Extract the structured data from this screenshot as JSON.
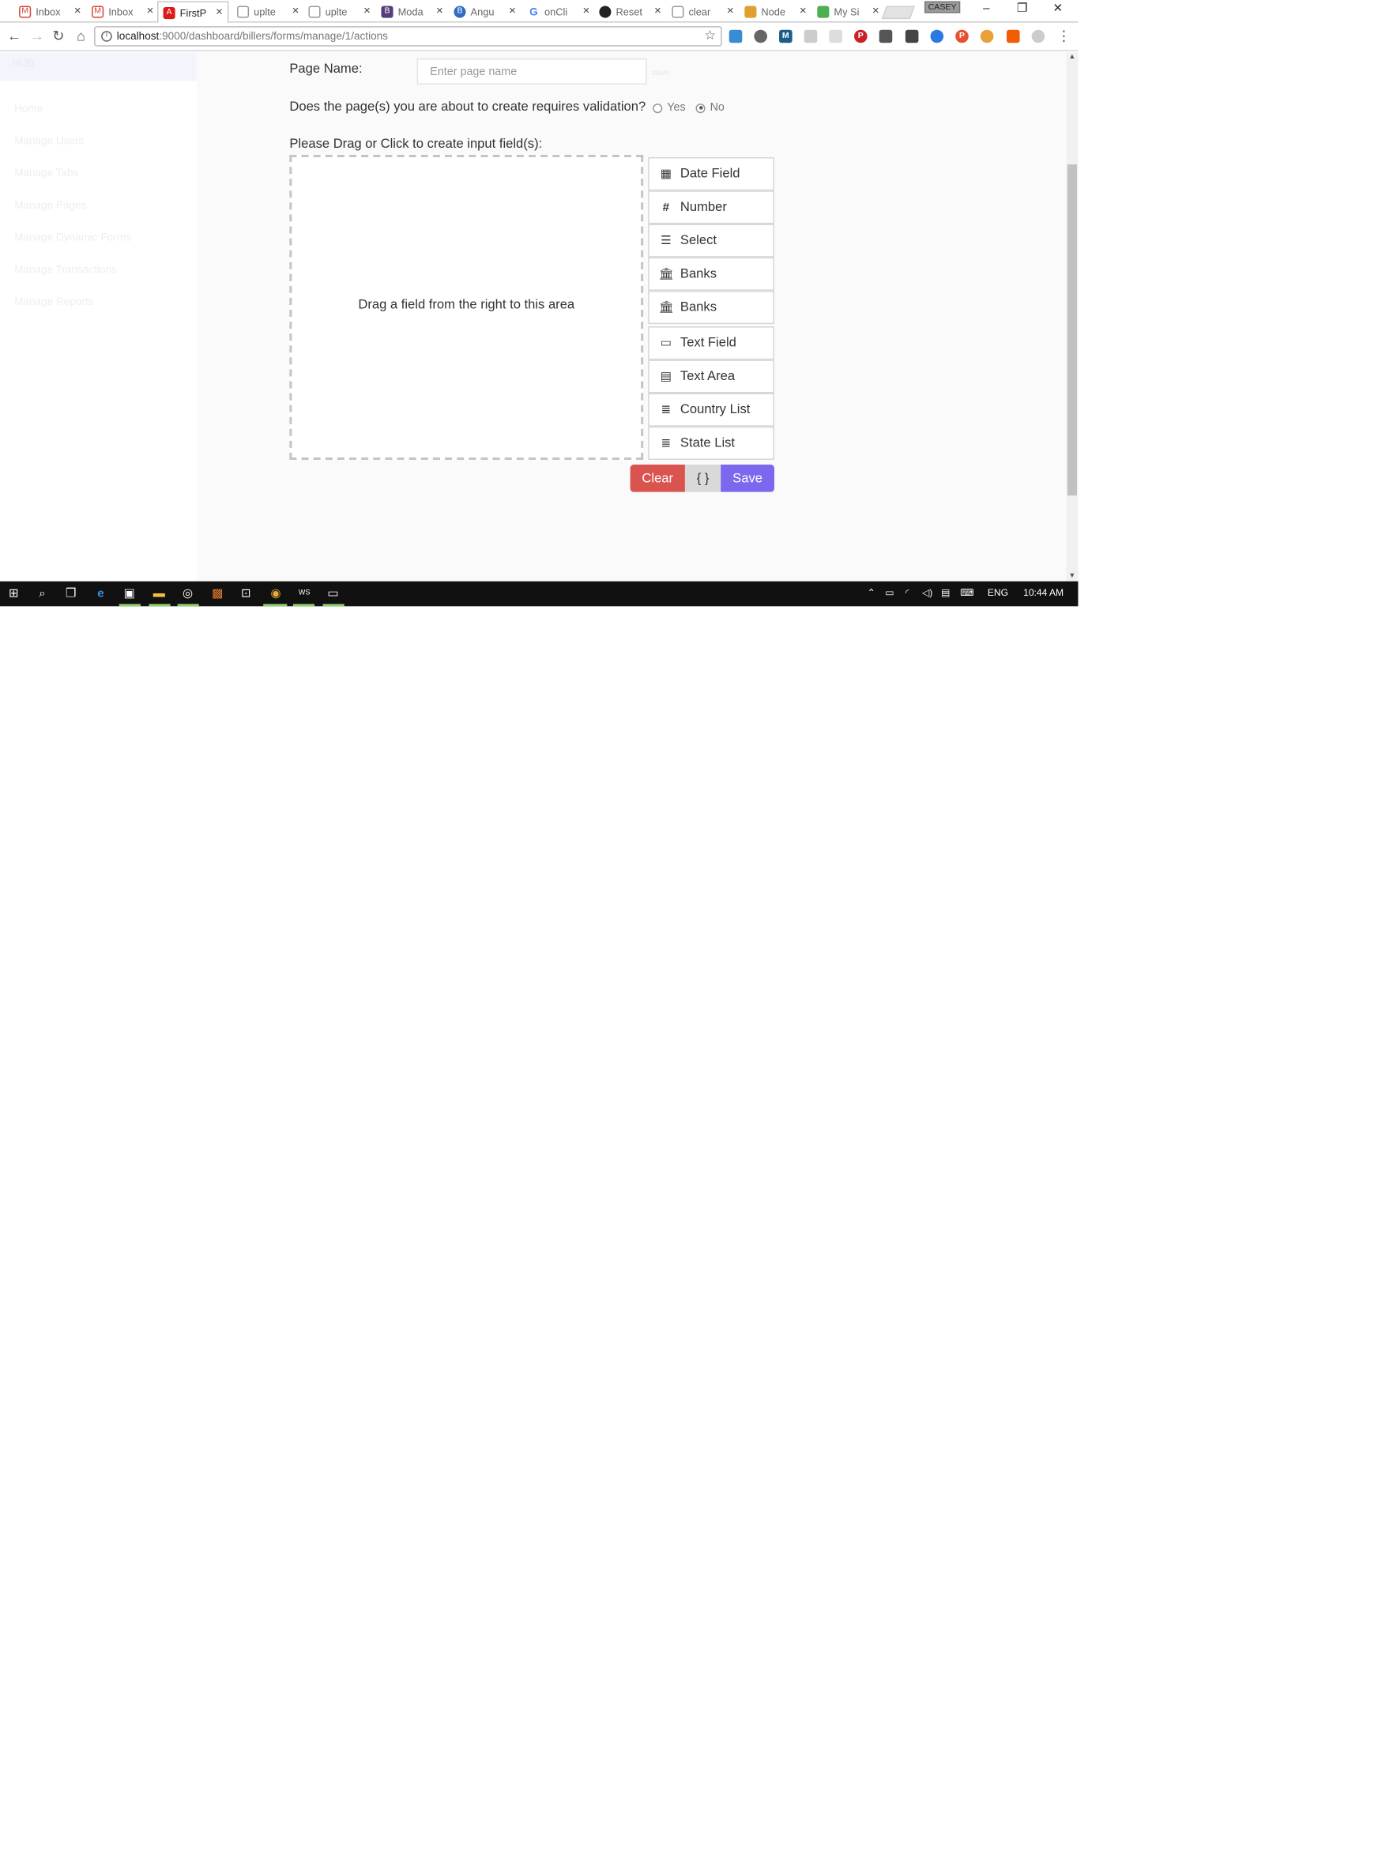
{
  "browser": {
    "tabs": [
      {
        "label": "Inbox",
        "icon": "gmail-icon",
        "color": "#d44638"
      },
      {
        "label": "Inbox",
        "icon": "gmail-icon",
        "color": "#d44638"
      },
      {
        "label": "FirstP",
        "icon": "angular-icon",
        "color": "#dd1b16"
      },
      {
        "label": "uplte",
        "icon": "page-icon",
        "color": "#999999"
      },
      {
        "label": "uplte",
        "icon": "page-icon",
        "color": "#999999"
      },
      {
        "label": "Moda",
        "icon": "bootstrap-icon",
        "color": "#563d7c"
      },
      {
        "label": "Angu",
        "icon": "bootstrap-icon",
        "color": "#2f6cc2"
      },
      {
        "label": "onCli",
        "icon": "google-icon",
        "color": "#4285f4"
      },
      {
        "label": "Reset",
        "icon": "github-icon",
        "color": "#222222"
      },
      {
        "label": "clear",
        "icon": "page-icon",
        "color": "#999999"
      },
      {
        "label": "Node",
        "icon": "node-icon",
        "color": "#e0a030"
      },
      {
        "label": "My Si",
        "icon": "maps-icon",
        "color": "#4caf50"
      }
    ],
    "user_badge": "CASEY",
    "url_host": "localhost",
    "url_rest": ":9000/dashboard/billers/forms/manage/1/actions"
  },
  "sidebar": {
    "title": "HUB",
    "items": [
      "Home",
      "Manage Users",
      "Manage Tabs",
      "Manage Pages",
      "Manage Dynamic Forms",
      "Manage Transactions",
      "Manage Reports"
    ]
  },
  "form": {
    "page_name_label": "Page Name:",
    "page_name_placeholder": "Enter page name",
    "page_name_value": "",
    "faint_label": "save",
    "validation_question": "Does the page(s) you are about to create requires validation?",
    "radio_yes": "Yes",
    "radio_no": "No",
    "selected": "No",
    "drag_instruction": "Please Drag or Click to create input field(s):",
    "dropzone_hint": "Drag a field from the right to this area"
  },
  "fields": [
    {
      "label": "Date Field",
      "icon": "calendar-icon"
    },
    {
      "label": "Number",
      "icon": "hash-icon"
    },
    {
      "label": "Select",
      "icon": "select-icon"
    },
    {
      "label": "Banks",
      "icon": "bank-icon"
    },
    {
      "label": "Banks",
      "icon": "bank-icon"
    },
    {
      "label": "Text Field",
      "icon": "text-field-icon"
    },
    {
      "label": "Text Area",
      "icon": "text-area-icon"
    },
    {
      "label": "Country List",
      "icon": "list-icon"
    },
    {
      "label": "State List",
      "icon": "list-icon"
    }
  ],
  "buttons": {
    "clear": "Clear",
    "json": "{ }",
    "save": "Save"
  },
  "colors": {
    "clear": "#d9534f",
    "save": "#7b68ee",
    "json": "#d9d9d9"
  },
  "taskbar": {
    "language": "ENG",
    "clock": "10:44 AM"
  }
}
